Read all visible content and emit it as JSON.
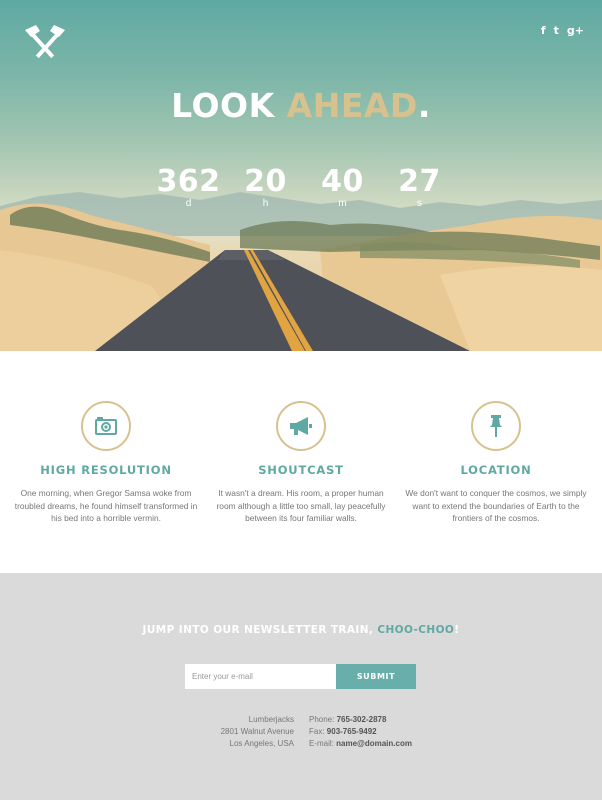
{
  "header": {
    "social": [
      {
        "icon": "facebook-icon",
        "glyph": "f"
      },
      {
        "icon": "twitter-icon",
        "glyph": "t"
      },
      {
        "icon": "google-plus-icon",
        "glyph": "g+"
      }
    ]
  },
  "hero": {
    "headline_1": "LOOK",
    "headline_2": "AHEAD",
    "headline_dot": ".",
    "countdown": [
      {
        "value": "362",
        "unit": "d"
      },
      {
        "value": "20",
        "unit": "h"
      },
      {
        "value": "40",
        "unit": "m"
      },
      {
        "value": "27",
        "unit": "s"
      }
    ]
  },
  "features": [
    {
      "icon": "camera-icon",
      "title": "HIGH RESOLUTION",
      "text": "One morning, when Gregor Samsa woke from troubled dreams, he found himself transformed in his bed into a horrible vermin."
    },
    {
      "icon": "megaphone-icon",
      "title": "SHOUTCAST",
      "text": "It wasn't a dream. His room, a proper human room although a little too small, lay peacefully between its four familiar walls."
    },
    {
      "icon": "pushpin-icon",
      "title": "LOCATION",
      "text": "We don't want to conquer the cosmos, we simply want to extend the boundaries of Earth to the frontiers of the cosmos."
    }
  ],
  "newsletter": {
    "title": "JUMP INTO OUR NEWSLETTER TRAIN,",
    "title_accent": "CHOO-CHOO",
    "title_end": "!",
    "placeholder": "Enter your e-mail",
    "submit": "SUBMIT"
  },
  "contact": {
    "address": [
      "Lumberjacks",
      "2801 Walnut Avenue",
      "Los Angeles, USA"
    ],
    "phone_label": "Phone:",
    "phone": "765-302-2878",
    "fax_label": "Fax:",
    "fax": "903-765-9492",
    "email_label": "E-mail:",
    "email": "name@domain.com"
  },
  "colors": {
    "accent_teal": "#5fa8a3",
    "accent_gold": "#d7c28f",
    "footer_bg": "#dadada"
  }
}
